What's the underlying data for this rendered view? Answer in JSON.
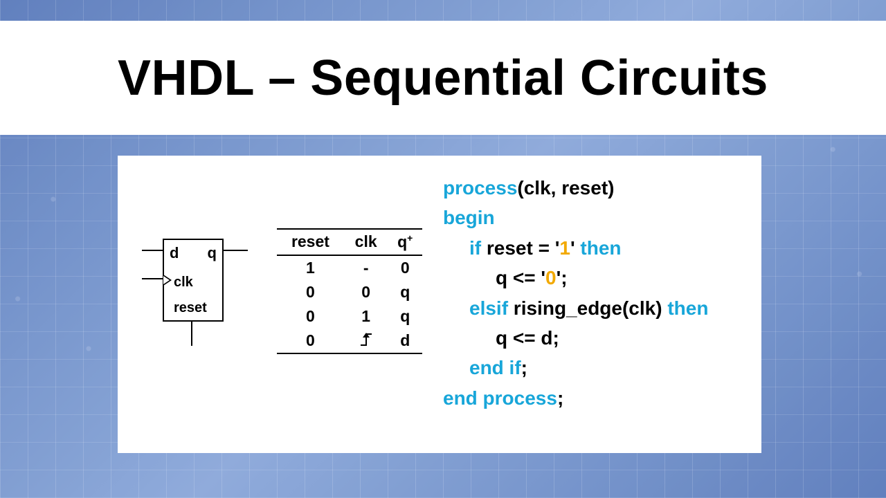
{
  "title": "VHDL – Sequential Circuits",
  "schematic": {
    "d": "d",
    "q": "q",
    "clk": "clk",
    "reset": "reset"
  },
  "truth_table": {
    "headers": {
      "reset": "reset",
      "clk": "clk",
      "qplus_base": "q",
      "qplus_sup": "+"
    },
    "rows": [
      {
        "reset": "1",
        "clk": "-",
        "q": "0"
      },
      {
        "reset": "0",
        "clk": "0",
        "q": "q"
      },
      {
        "reset": "0",
        "clk": "1",
        "q": "q"
      },
      {
        "reset": "0",
        "clk": "edge",
        "q": "d"
      }
    ]
  },
  "code": {
    "kw_process": "process",
    "sensitivity": "(clk, reset)",
    "kw_begin": "begin",
    "kw_if": "if",
    "cond_reset_pre": " reset = '",
    "lit_one": "1",
    "cond_reset_post": "' ",
    "kw_then": "then",
    "assign_q_pre": "q <= '",
    "lit_zero": "0",
    "assign_q_post": "';",
    "kw_elsif": "elsif",
    "cond_rise": " rising_edge(clk) ",
    "assign_q_d": "q <= d;",
    "kw_endif": "end if",
    "semi": ";",
    "kw_endprocess": "end process"
  }
}
